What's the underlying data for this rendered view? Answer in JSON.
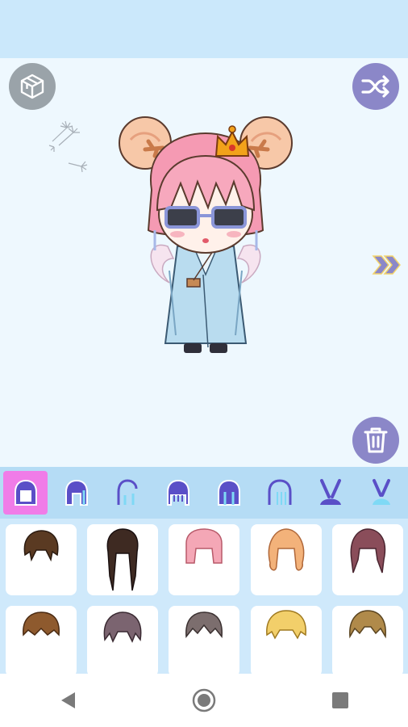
{
  "toolbar": {
    "view_3d_icon": "cube-3d-icon",
    "shuffle_icon": "shuffle-icon",
    "delete_icon": "trash-icon",
    "next_icon": "double-chevron-right-icon"
  },
  "colors": {
    "top_bar": "#cbe8fb",
    "stage_bg": "#eef8fe",
    "tab_bar": "#b5dcf5",
    "tab_active": "#f07ce8",
    "items_panel": "#cfe9fb",
    "accent_button": "#8b87c8",
    "grey_button": "#9aa3a9"
  },
  "category_tabs": [
    {
      "name": "hair-full",
      "icon": "hair-full-icon",
      "active": true
    },
    {
      "name": "hair-front",
      "icon": "hair-front-icon",
      "active": false
    },
    {
      "name": "hair-side",
      "icon": "hair-side-icon",
      "active": false
    },
    {
      "name": "hair-bangs",
      "icon": "hair-bangs-icon",
      "active": false
    },
    {
      "name": "hair-back",
      "icon": "hair-back-icon",
      "active": false
    },
    {
      "name": "hair-outline",
      "icon": "hair-outline-icon",
      "active": false
    },
    {
      "name": "bunny-ears",
      "icon": "bunny-ears-icon",
      "active": false
    },
    {
      "name": "bunny-ears-alt",
      "icon": "bunny-ears-alt-icon",
      "active": false
    }
  ],
  "hair_items": [
    {
      "color": "#5a3a22"
    },
    {
      "color": "#3e2a22"
    },
    {
      "color": "#f4a7b6"
    },
    {
      "color": "#f3b27a"
    },
    {
      "color": "#8a4d5a"
    },
    {
      "color": "#8e5a2e"
    },
    {
      "color": "#7b6470"
    },
    {
      "color": "#7c6e6e"
    },
    {
      "color": "#f2cf6a"
    },
    {
      "color": "#b08a4a"
    }
  ],
  "nav": {
    "back_icon": "back-triangle-icon",
    "home_icon": "home-circle-icon",
    "recents_icon": "recents-square-icon"
  }
}
